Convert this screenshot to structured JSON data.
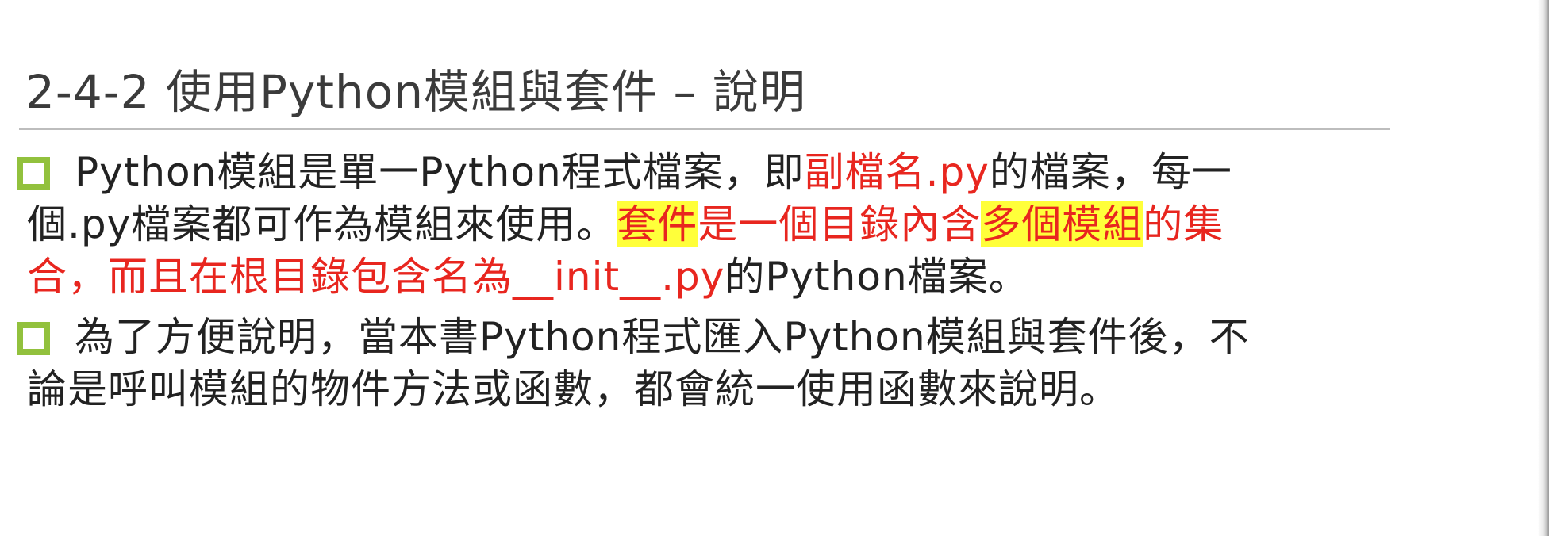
{
  "slide": {
    "title": "2-4-2 使用Python模組與套件 – 說明",
    "bullets": [
      {
        "segments": [
          {
            "text": "Python模組是單一Python程式檔案，即",
            "style": "normal"
          },
          {
            "text": "副檔名.py",
            "style": "red"
          },
          {
            "text": "的檔案，每一",
            "style": "normal"
          }
        ],
        "line2": [
          {
            "text": "個.py檔案都可作為模組來使用。",
            "style": "normal"
          },
          {
            "text": "套件",
            "style": "red-highlight"
          },
          {
            "text": "是一個目錄內含",
            "style": "red"
          },
          {
            "text": "多個模組",
            "style": "red-highlight"
          },
          {
            "text": "的集",
            "style": "red"
          }
        ],
        "line3": [
          {
            "text": "合，而且在根目錄包含名為__init__.py",
            "style": "red"
          },
          {
            "text": "的Python檔案。",
            "style": "normal"
          }
        ]
      },
      {
        "line1": "為了方便說明，當本書Python程式匯入Python模組與套件後，不",
        "line2": "論是呼叫模組的物件方法或函數，都會統一使用函數來說明。"
      }
    ],
    "colors": {
      "title_text": "#3b3b3b",
      "body_text": "#222222",
      "emphasis_red": "#e8261f",
      "highlight_yellow": "#ffff3a",
      "bullet_green": "#92c13d",
      "rule_gray": "#bdbdbd"
    },
    "icons": {
      "bullet": "hollow-square-bullet-icon"
    }
  }
}
